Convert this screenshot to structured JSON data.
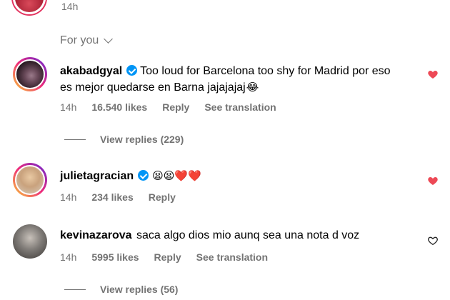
{
  "top": {
    "time": "14h"
  },
  "section": {
    "label": "For you"
  },
  "comments": [
    {
      "username": "akabadgyal",
      "text": "Too loud for Barcelona too shy for Madrid por eso es mejor quedarse en Barna jajajajaj",
      "emoji": "😂",
      "time": "14h",
      "likes": "16.540 likes",
      "reply": "Reply",
      "see_translation": "See translation",
      "view_replies": "View replies (229)",
      "liked": true
    },
    {
      "username": "julietagracian",
      "text": "",
      "emoji": "😫😫❤️❤️",
      "time": "14h",
      "likes": "234 likes",
      "reply": "Reply",
      "liked": true
    },
    {
      "username": "kevinazarova",
      "text": "saca algo dios mio aunq sea una nota d voz",
      "time": "14h",
      "likes": "5995 likes",
      "reply": "Reply",
      "see_translation": "See translation",
      "view_replies": "View replies (56)",
      "liked": false
    }
  ],
  "colors": {
    "heart_red": "#ed4956",
    "verified_blue": "#0095f6",
    "muted": "#737373"
  }
}
